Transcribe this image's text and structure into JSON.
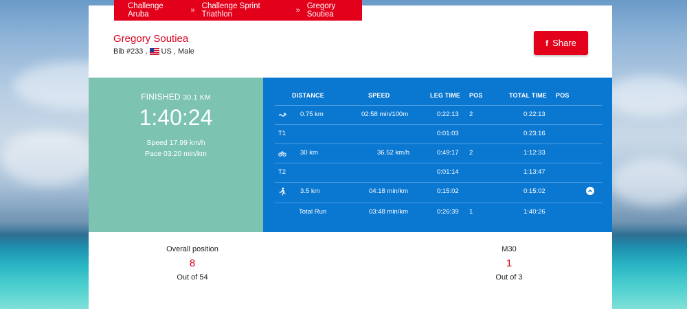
{
  "breadcrumb": {
    "items": [
      "Challenge Aruba",
      "Challenge Sprint Triathlon",
      "Gregory Soutiea"
    ],
    "separator": "»"
  },
  "athlete": {
    "name": "Gregory Soutiea",
    "bib": "Bib #233 ,",
    "country": "US , Male"
  },
  "share_label": "Share",
  "summary": {
    "status": "FINISHED",
    "distance": "30.1 KM",
    "time": "1:40:24",
    "speed": "Speed 17.99 km/h",
    "pace": "Pace 03:20 min/km"
  },
  "splits": {
    "headers": {
      "distance": "DISTANCE",
      "speed": "SPEED",
      "leg_time": "LEG TIME",
      "pos": "POS",
      "total_time": "TOTAL TIME",
      "pos2": "POS"
    },
    "rows": [
      {
        "icon": "swim-icon",
        "label": "",
        "distance": "0.75 km",
        "speed": "02:58 min/100m",
        "leg_time": "0:22:13",
        "pos": "2",
        "total_time": "0:22:13",
        "pos2": ""
      },
      {
        "icon": "",
        "label": "T1",
        "distance": "",
        "speed": "",
        "leg_time": "0:01:03",
        "pos": "",
        "total_time": "0:23:16",
        "pos2": ""
      },
      {
        "icon": "bike-icon",
        "label": "",
        "distance": "30 km",
        "speed": "36.52 km/h",
        "leg_time": "0:49:17",
        "pos": "2",
        "total_time": "1:12:33",
        "pos2": ""
      },
      {
        "icon": "",
        "label": "T2",
        "distance": "",
        "speed": "",
        "leg_time": "0:01:14",
        "pos": "",
        "total_time": "1:13:47",
        "pos2": ""
      },
      {
        "icon": "run-icon",
        "label": "",
        "distance": "3.5 km",
        "speed": "04:18 min/km",
        "leg_time": "0:15:02",
        "pos": "",
        "total_time": "0:15:02",
        "pos2": ""
      },
      {
        "icon": "",
        "label": "",
        "distance": "Total Run",
        "speed": "03:48 min/km",
        "leg_time": "0:26:39",
        "pos": "1",
        "total_time": "1:40:26",
        "pos2": ""
      }
    ]
  },
  "overall": {
    "label": "Overall position",
    "value": "8",
    "out_of": "Out of 54"
  },
  "category": {
    "label": "M30",
    "value": "1",
    "out_of": "Out of 3"
  },
  "colors": {
    "accent_red": "#e3001b",
    "finish_green": "#7cc3b2",
    "splits_blue": "#0a77d1"
  }
}
